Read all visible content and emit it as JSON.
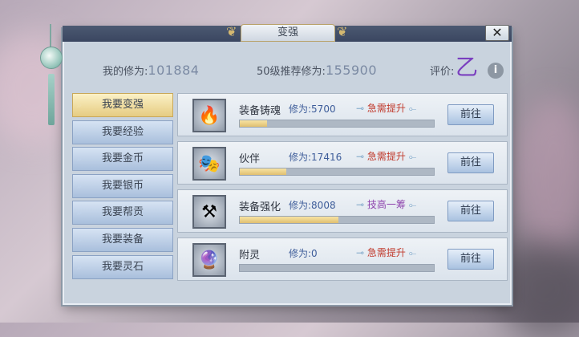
{
  "window": {
    "title": "变强",
    "close_symbol": "✕"
  },
  "stats": {
    "my_label": "我的修为:",
    "my_value": "101884",
    "recommend_label": "50级推荐修为:",
    "recommend_value": "155900",
    "grade_label": "评价:",
    "grade_value": "乙",
    "info_symbol": "i"
  },
  "sidebar": {
    "items": [
      {
        "label": "我要变强",
        "active": true
      },
      {
        "label": "我要经验",
        "active": false
      },
      {
        "label": "我要金币",
        "active": false
      },
      {
        "label": "我要银币",
        "active": false
      },
      {
        "label": "我要帮贡",
        "active": false
      },
      {
        "label": "我要装备",
        "active": false
      },
      {
        "label": "我要灵石",
        "active": false
      }
    ]
  },
  "rows": [
    {
      "name": "装备铸魂",
      "cultivation": "修为:5700",
      "status": "急需提升",
      "status_color": "#c0392b",
      "progress": 0.14,
      "button": "前往",
      "icon": "soul-flame-icon",
      "glyph": "🔥"
    },
    {
      "name": "伙伴",
      "cultivation": "修为:17416",
      "status": "急需提升",
      "status_color": "#c0392b",
      "progress": 0.24,
      "button": "前往",
      "icon": "mask-icon",
      "glyph": "🎭"
    },
    {
      "name": "装备强化",
      "cultivation": "修为:8008",
      "status": "技高一筹",
      "status_color": "#8e44ad",
      "progress": 0.51,
      "button": "前往",
      "icon": "anvil-icon",
      "glyph": "⚒"
    },
    {
      "name": "附灵",
      "cultivation": "修为:0",
      "status": "急需提升",
      "status_color": "#c0392b",
      "progress": 0.0,
      "button": "前往",
      "icon": "spirit-orb-icon",
      "glyph": "🔮"
    }
  ]
}
